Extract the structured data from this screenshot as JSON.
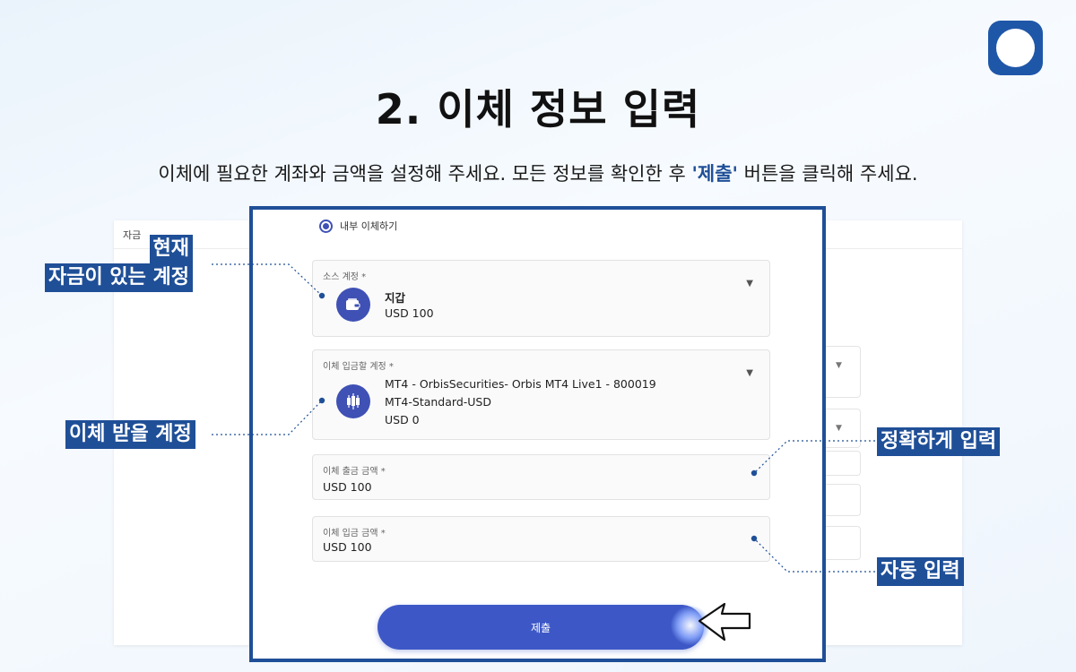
{
  "header": {
    "title": "2. 이체 정보 입력",
    "subtitle_before": "이체에 필요한 계좌와 금액을 설정해 주세요. 모든 정보를 확인한 후 ",
    "subtitle_highlight": "'제출'",
    "subtitle_after": " 버튼을 클릭해 주세요."
  },
  "background_panel": {
    "header_label": "자금"
  },
  "form": {
    "radio_label": "내부 이체하기",
    "source": {
      "label": "소스 계정 *",
      "name": "지갑",
      "balance": "USD 100"
    },
    "destination": {
      "label": "이체 입금할 계정 *",
      "line1": "MT4 - OrbisSecurities- Orbis MT4 Live1 - 800019",
      "line2": "MT4-Standard-USD",
      "balance": "USD 0"
    },
    "withdraw_amount": {
      "label": "이체 출금 금액 *",
      "value": "USD 100"
    },
    "deposit_amount": {
      "label": "이체 입금 금액 *",
      "value": "USD 100"
    },
    "submit_label": "제출"
  },
  "callouts": {
    "source_line1": "현재",
    "source_line2": "자금이 있는 계정",
    "destination": "이체 받을 계정",
    "withdraw": "정확하게 입력",
    "deposit": "자동 입력"
  },
  "colors": {
    "brand": "#1f4f97",
    "accent": "#3f51b5",
    "button": "#3d58c6"
  },
  "icons": {
    "logo": "app-logo-icon",
    "source": "wallet-icon",
    "destination": "candlestick-icon",
    "cursor": "mouse-pointer-icon"
  }
}
